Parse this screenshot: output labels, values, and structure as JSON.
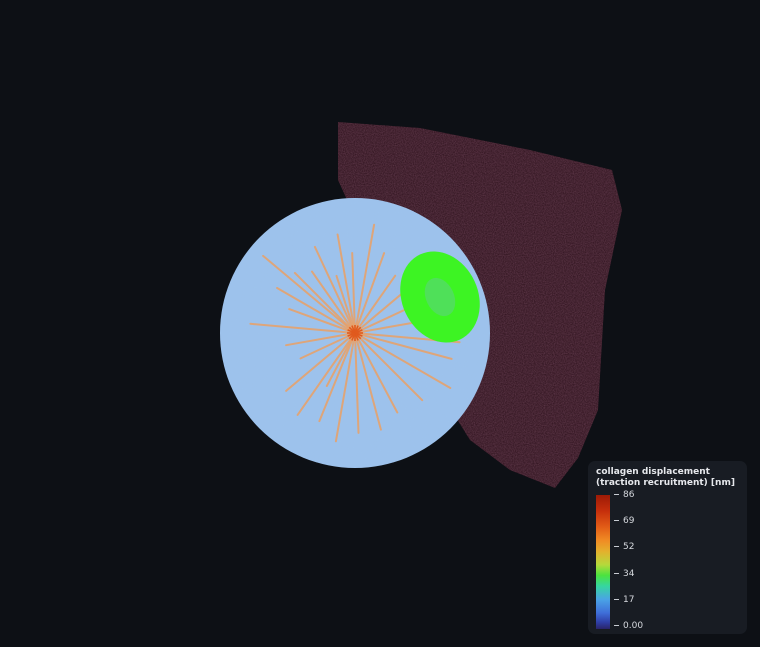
{
  "colors": {
    "background": "#0d1015",
    "sphere": "#9dc3ee",
    "fibers": "#eaa066",
    "center_marker": "#e05a1e",
    "green_patch": "#3df423",
    "red_volume": "#3a1420",
    "legend_bg": "#181c23"
  },
  "legend": {
    "title": "collagen displacement (traction recruitment) [nm]",
    "ticks": [
      {
        "label": "86",
        "value": 86
      },
      {
        "label": "69",
        "value": 69
      },
      {
        "label": "52",
        "value": 52
      },
      {
        "label": "34",
        "value": 34
      },
      {
        "label": "17",
        "value": 17
      },
      {
        "label": "0.00",
        "value": 0
      }
    ],
    "range": [
      0,
      86
    ]
  }
}
